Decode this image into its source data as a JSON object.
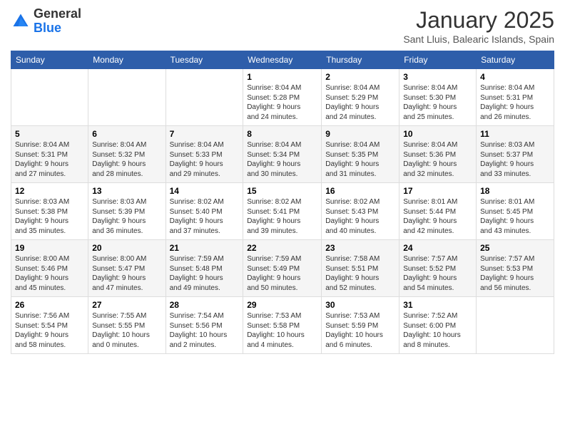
{
  "header": {
    "logo": {
      "line1": "General",
      "line2": "Blue"
    },
    "title": "January 2025",
    "location": "Sant Lluis, Balearic Islands, Spain"
  },
  "weekdays": [
    "Sunday",
    "Monday",
    "Tuesday",
    "Wednesday",
    "Thursday",
    "Friday",
    "Saturday"
  ],
  "weeks": [
    [
      {
        "day": "",
        "content": ""
      },
      {
        "day": "",
        "content": ""
      },
      {
        "day": "",
        "content": ""
      },
      {
        "day": "1",
        "content": "Sunrise: 8:04 AM\nSunset: 5:28 PM\nDaylight: 9 hours\nand 24 minutes."
      },
      {
        "day": "2",
        "content": "Sunrise: 8:04 AM\nSunset: 5:29 PM\nDaylight: 9 hours\nand 24 minutes."
      },
      {
        "day": "3",
        "content": "Sunrise: 8:04 AM\nSunset: 5:30 PM\nDaylight: 9 hours\nand 25 minutes."
      },
      {
        "day": "4",
        "content": "Sunrise: 8:04 AM\nSunset: 5:31 PM\nDaylight: 9 hours\nand 26 minutes."
      }
    ],
    [
      {
        "day": "5",
        "content": "Sunrise: 8:04 AM\nSunset: 5:31 PM\nDaylight: 9 hours\nand 27 minutes."
      },
      {
        "day": "6",
        "content": "Sunrise: 8:04 AM\nSunset: 5:32 PM\nDaylight: 9 hours\nand 28 minutes."
      },
      {
        "day": "7",
        "content": "Sunrise: 8:04 AM\nSunset: 5:33 PM\nDaylight: 9 hours\nand 29 minutes."
      },
      {
        "day": "8",
        "content": "Sunrise: 8:04 AM\nSunset: 5:34 PM\nDaylight: 9 hours\nand 30 minutes."
      },
      {
        "day": "9",
        "content": "Sunrise: 8:04 AM\nSunset: 5:35 PM\nDaylight: 9 hours\nand 31 minutes."
      },
      {
        "day": "10",
        "content": "Sunrise: 8:04 AM\nSunset: 5:36 PM\nDaylight: 9 hours\nand 32 minutes."
      },
      {
        "day": "11",
        "content": "Sunrise: 8:03 AM\nSunset: 5:37 PM\nDaylight: 9 hours\nand 33 minutes."
      }
    ],
    [
      {
        "day": "12",
        "content": "Sunrise: 8:03 AM\nSunset: 5:38 PM\nDaylight: 9 hours\nand 35 minutes."
      },
      {
        "day": "13",
        "content": "Sunrise: 8:03 AM\nSunset: 5:39 PM\nDaylight: 9 hours\nand 36 minutes."
      },
      {
        "day": "14",
        "content": "Sunrise: 8:02 AM\nSunset: 5:40 PM\nDaylight: 9 hours\nand 37 minutes."
      },
      {
        "day": "15",
        "content": "Sunrise: 8:02 AM\nSunset: 5:41 PM\nDaylight: 9 hours\nand 39 minutes."
      },
      {
        "day": "16",
        "content": "Sunrise: 8:02 AM\nSunset: 5:43 PM\nDaylight: 9 hours\nand 40 minutes."
      },
      {
        "day": "17",
        "content": "Sunrise: 8:01 AM\nSunset: 5:44 PM\nDaylight: 9 hours\nand 42 minutes."
      },
      {
        "day": "18",
        "content": "Sunrise: 8:01 AM\nSunset: 5:45 PM\nDaylight: 9 hours\nand 43 minutes."
      }
    ],
    [
      {
        "day": "19",
        "content": "Sunrise: 8:00 AM\nSunset: 5:46 PM\nDaylight: 9 hours\nand 45 minutes."
      },
      {
        "day": "20",
        "content": "Sunrise: 8:00 AM\nSunset: 5:47 PM\nDaylight: 9 hours\nand 47 minutes."
      },
      {
        "day": "21",
        "content": "Sunrise: 7:59 AM\nSunset: 5:48 PM\nDaylight: 9 hours\nand 49 minutes."
      },
      {
        "day": "22",
        "content": "Sunrise: 7:59 AM\nSunset: 5:49 PM\nDaylight: 9 hours\nand 50 minutes."
      },
      {
        "day": "23",
        "content": "Sunrise: 7:58 AM\nSunset: 5:51 PM\nDaylight: 9 hours\nand 52 minutes."
      },
      {
        "day": "24",
        "content": "Sunrise: 7:57 AM\nSunset: 5:52 PM\nDaylight: 9 hours\nand 54 minutes."
      },
      {
        "day": "25",
        "content": "Sunrise: 7:57 AM\nSunset: 5:53 PM\nDaylight: 9 hours\nand 56 minutes."
      }
    ],
    [
      {
        "day": "26",
        "content": "Sunrise: 7:56 AM\nSunset: 5:54 PM\nDaylight: 9 hours\nand 58 minutes."
      },
      {
        "day": "27",
        "content": "Sunrise: 7:55 AM\nSunset: 5:55 PM\nDaylight: 10 hours\nand 0 minutes."
      },
      {
        "day": "28",
        "content": "Sunrise: 7:54 AM\nSunset: 5:56 PM\nDaylight: 10 hours\nand 2 minutes."
      },
      {
        "day": "29",
        "content": "Sunrise: 7:53 AM\nSunset: 5:58 PM\nDaylight: 10 hours\nand 4 minutes."
      },
      {
        "day": "30",
        "content": "Sunrise: 7:53 AM\nSunset: 5:59 PM\nDaylight: 10 hours\nand 6 minutes."
      },
      {
        "day": "31",
        "content": "Sunrise: 7:52 AM\nSunset: 6:00 PM\nDaylight: 10 hours\nand 8 minutes."
      },
      {
        "day": "",
        "content": ""
      }
    ]
  ]
}
